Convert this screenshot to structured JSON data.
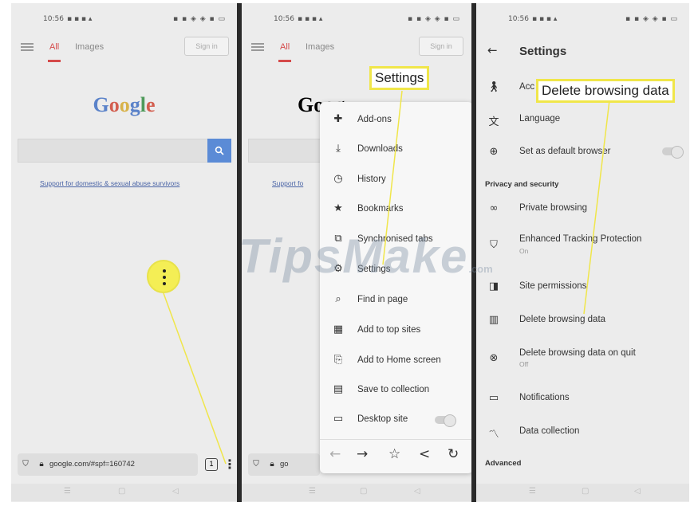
{
  "status": {
    "time": "10:56",
    "left_icons": "▪ ▪ ▪ ▴",
    "right_icons": "▪ ▪ ◈ ◈ ▪ ▭"
  },
  "panel1": {
    "tab_all": "All",
    "tab_images": "Images",
    "signin": "Sign in",
    "logo": [
      "G",
      "o",
      "o",
      "g",
      "l",
      "e"
    ],
    "search_icon": "search-icon",
    "support_link": "Support for domestic & sexual abuse survivors",
    "url": "google.com/#spf=160742",
    "tab_count": "1"
  },
  "panel2": {
    "tab_all": "All",
    "tab_images": "Images",
    "signin": "Sign in",
    "logo_partial": "Goog",
    "support_partial": "Support fo",
    "url_partial": "go",
    "callout": "Settings",
    "menu": [
      {
        "icon": "puzzle-icon",
        "label": "Add-ons"
      },
      {
        "icon": "download-icon",
        "label": "Downloads"
      },
      {
        "icon": "clock-icon",
        "label": "History"
      },
      {
        "icon": "star-icon",
        "label": "Bookmarks"
      },
      {
        "icon": "sync-tabs-icon",
        "label": "Synchronised tabs"
      },
      {
        "icon": "gear-icon",
        "label": "Settings"
      },
      {
        "icon": "search-icon",
        "label": "Find in page"
      },
      {
        "icon": "grid-icon",
        "label": "Add to top sites"
      },
      {
        "icon": "add-home-icon",
        "label": "Add to Home screen"
      },
      {
        "icon": "collection-icon",
        "label": "Save to collection"
      },
      {
        "icon": "laptop-icon",
        "label": "Desktop site"
      }
    ]
  },
  "panel3": {
    "title": "Settings",
    "callout": "Delete browsing data",
    "items_top": [
      {
        "icon": "accessibility-icon",
        "label": "Acc"
      },
      {
        "icon": "translate-icon",
        "label": "Language"
      },
      {
        "icon": "globe-icon",
        "label": "Set as default browser"
      }
    ],
    "section_privacy": "Privacy and security",
    "items_privacy": [
      {
        "icon": "mask-icon",
        "label": "Private browsing",
        "sub": ""
      },
      {
        "icon": "shield-icon",
        "label": "Enhanced Tracking Protection",
        "sub": "On"
      },
      {
        "icon": "permissions-icon",
        "label": "Site permissions",
        "sub": ""
      },
      {
        "icon": "trash-icon",
        "label": "Delete browsing data",
        "sub": ""
      },
      {
        "icon": "clear-icon",
        "label": "Delete browsing data on quit",
        "sub": "Off"
      },
      {
        "icon": "chat-icon",
        "label": "Notifications",
        "sub": ""
      },
      {
        "icon": "chart-line-icon",
        "label": "Data collection",
        "sub": ""
      }
    ],
    "section_advanced": "Advanced"
  },
  "watermark": {
    "main": "TipsMake",
    "suffix": ".com"
  },
  "colors": {
    "highlight": "#f0e64a",
    "accent_red": "#d54a4a",
    "search_blue": "#5b8bd6"
  }
}
